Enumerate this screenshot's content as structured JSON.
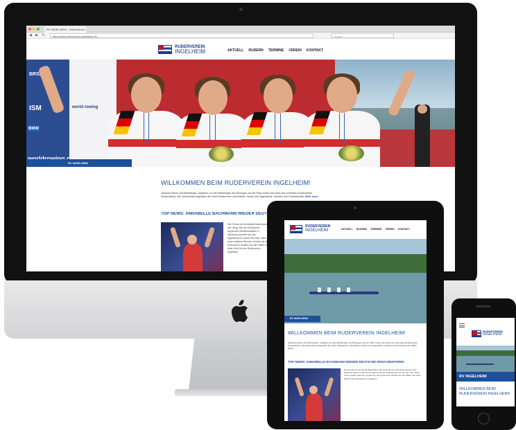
{
  "browser": {
    "tab_title": "RV INGELHEIM – Ruderverein ...",
    "url": "http://www.ruderverein-ingelheim.de",
    "search_placeholder": "Suche"
  },
  "site": {
    "logo_line1": "RUDERVEREIN",
    "logo_line2": "INGELHEIM",
    "nav": [
      "AKTUELL",
      "RUDERN",
      "TERMINE",
      "VEREIN",
      "KONTAKT"
    ],
    "hero_caption": "RV INGELHEIM",
    "sponsors": [
      "BRSL",
      "ISM",
      "world rowing",
      "BMW",
      "worldrowing.com"
    ],
    "welcome_title": "WILLKOMMEN BEIM RUDERVEREIN INGELHEIM!",
    "intro_text": "Zwischen Rhein und Weinbergen, umgeben von den Weinbergen des Rheingau und der Pfalz, findet man einen der schönsten Rudervereine Deutschlands. Seit Jahrzehnten begeistert der Verein Ruderinnen und Ruderer, Kinder und Jugendliche, Familien und Freizeitsportler. ",
    "more_link": "Mehr lesen",
    "news_title": "TOP NEWS: ANNABELLE BACHMANN WIEDER DEUTSCHE ERGO-MEISTERIN",
    "news_text": "Die Freude bei Annabelle Bachmann war riesig: Bei den Deutschen Ergometer-Meisterschaften in Hamburg sicherte sich die Ingelheimerin erneut den Titel. Nach einem starken Rennen verwies sie die Konkurrenz deutlich auf die Plätze und holte Gold für den Ruderverein Ingelheim."
  },
  "colors": {
    "brand_blue": "#1d4f9c",
    "flag_red": "#c8102e"
  },
  "icons": [
    "apple-logo-icon",
    "hamburger-menu-icon",
    "back-arrow-icon",
    "forward-arrow-icon",
    "reload-icon"
  ]
}
